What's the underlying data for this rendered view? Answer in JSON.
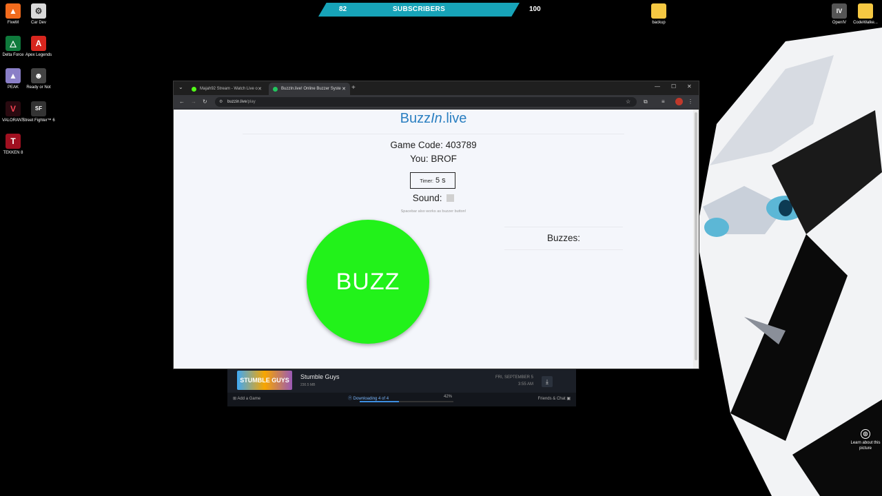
{
  "desktop": {
    "left_icons": [
      {
        "label": "FiveM",
        "icon": "fivem-icon",
        "color": "#f26b1d",
        "glyph": "▲"
      },
      {
        "label": "Car Dev",
        "icon": "car-dev-icon",
        "color": "#d9d9d9",
        "glyph": "⚙"
      },
      {
        "label": "Delta Force",
        "icon": "delta-force-icon",
        "color": "#0f7a3c",
        "glyph": "△"
      },
      {
        "label": "Apex Legends",
        "icon": "apex-legends-icon",
        "color": "#d7261e",
        "glyph": "A"
      },
      {
        "label": "PEAK",
        "icon": "peak-icon",
        "color": "#8a7fc7",
        "glyph": "▲"
      },
      {
        "label": "Ready or Not",
        "icon": "ready-or-not-icon",
        "color": "#444444",
        "glyph": "☻"
      },
      {
        "label": "VALORANT",
        "icon": "valorant-icon",
        "color": "#fa4454",
        "glyph": "V"
      },
      {
        "label": "Street Fighter™ 6",
        "icon": "street-fighter-icon",
        "color": "#333333",
        "glyph": "SF"
      },
      {
        "label": "TEKKEN 8",
        "icon": "tekken-icon",
        "color": "#a01020",
        "glyph": "T"
      }
    ],
    "right_icons": [
      {
        "label": "backup",
        "icon": "folder-icon",
        "color": "#f5c842",
        "glyph": "▬"
      },
      {
        "label": "OpenIV",
        "icon": "openiv-icon",
        "color": "#555555",
        "glyph": "IV"
      },
      {
        "label": "CodeWalke...",
        "icon": "folder-icon",
        "color": "#f5c842",
        "glyph": "▬"
      }
    ],
    "learn_more": "Learn about this picture"
  },
  "subscriber_bar": {
    "current": "82",
    "label": "SUBSCRIBERS",
    "goal": "100",
    "color": "#17a3b8"
  },
  "browser": {
    "tabs": [
      {
        "title": "Majah92 Stream - Watch Live o",
        "favicon_color": "#53fc18",
        "active": false
      },
      {
        "title": "BuzzIn.live! Online Buzzer Syste",
        "favicon_color": "#22c55e",
        "active": true
      }
    ],
    "url_host": "buzzin.live",
    "url_path": "/play"
  },
  "page": {
    "brand_main": "Buzz",
    "brand_italic": "In",
    "brand_tail": ".live",
    "game_code": "Game Code: 403789",
    "you": "You: BROF",
    "timer_label": "Timer:",
    "timer_value": "5 s",
    "sound_label": "Sound:",
    "hint": "Spacebar also works as buzzer button!",
    "buzz_label": "BUZZ",
    "buzzes_label": "Buzzes:",
    "accent_color": "#2a7fc1",
    "buzz_color": "#22f21a"
  },
  "steam": {
    "game_title": "Stumble Guys",
    "thumb_text": "STUMBLE GUYS",
    "size": "230.5 MB",
    "date": "FRI, SEPTEMBER 5",
    "time": "3:55 AM",
    "add_game": "Add a Game",
    "downloading": "Downloading 4 of 4",
    "progress_pct": "42%",
    "progress": 0.42,
    "friends": "Friends & Chat"
  }
}
